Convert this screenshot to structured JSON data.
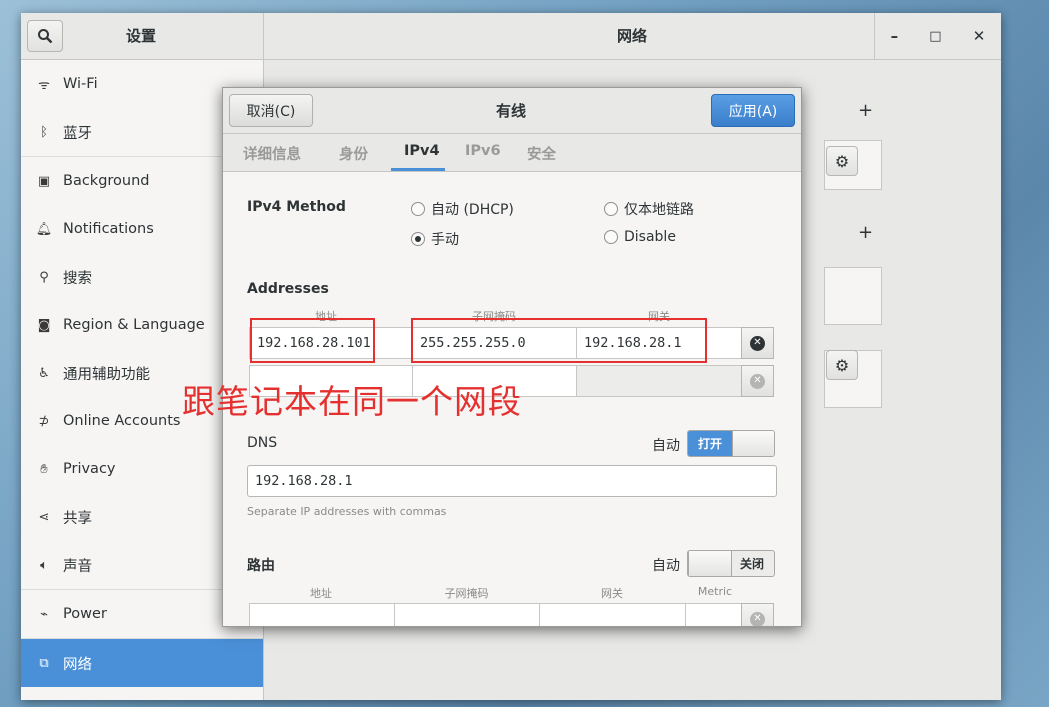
{
  "window": {
    "sidebar_title": "设置",
    "main_title": "网络",
    "controls": {
      "minimize": "–",
      "maximize": "□",
      "close": "✕"
    }
  },
  "sidebar": {
    "items": [
      {
        "label": "Wi-Fi",
        "icon": "wifi-icon",
        "glyph": "ᯤ"
      },
      {
        "label": "蓝牙",
        "icon": "bluetooth-icon",
        "glyph": "ᛒ"
      },
      {
        "label": "Background",
        "icon": "background-icon",
        "glyph": "▣"
      },
      {
        "label": "Notifications",
        "icon": "bell-icon",
        "glyph": "🔔︎"
      },
      {
        "label": "搜索",
        "icon": "search-icon",
        "glyph": "⚲"
      },
      {
        "label": "Region & Language",
        "icon": "camera-icon",
        "glyph": "◙"
      },
      {
        "label": "通用辅助功能",
        "icon": "accessibility-icon",
        "glyph": "♿︎"
      },
      {
        "label": "Online Accounts",
        "icon": "online-accounts-icon",
        "glyph": "⊅"
      },
      {
        "label": "Privacy",
        "icon": "hand-icon",
        "glyph": "✋︎"
      },
      {
        "label": "共享",
        "icon": "share-icon",
        "glyph": "⋖"
      },
      {
        "label": "声音",
        "icon": "speaker-icon",
        "glyph": "🔈︎"
      },
      {
        "label": "Power",
        "icon": "power-icon",
        "glyph": "⌁"
      },
      {
        "label": "网络",
        "icon": "network-icon",
        "glyph": "⧉",
        "active": true
      }
    ]
  },
  "dialog": {
    "cancel_label": "取消(C)",
    "title": "有线",
    "apply_label": "应用(A)",
    "tabs": [
      "详细信息",
      "身份",
      "IPv4",
      "IPv6",
      "安全"
    ],
    "active_tab": "IPv4",
    "ipv4_method_label": "IPv4 Method",
    "methods": [
      {
        "label": "自动 (DHCP)",
        "selected": false
      },
      {
        "label": "仅本地链路",
        "selected": false
      },
      {
        "label": "手动",
        "selected": true
      },
      {
        "label": "Disable",
        "selected": false
      }
    ],
    "addresses_label": "Addresses",
    "address_columns": [
      "地址",
      "子网掩码",
      "网关"
    ],
    "address_rows": [
      {
        "address": "192.168.28.101",
        "netmask": "255.255.255.0",
        "gateway": "192.168.28.1"
      },
      {
        "address": "",
        "netmask": "",
        "gateway": ""
      }
    ],
    "dns_label": "DNS",
    "dns_auto_label": "自动",
    "dns_switch_label": "打开",
    "dns_value": "192.168.28.1",
    "dns_hint": "Separate IP addresses with commas",
    "routes_label": "路由",
    "routes_auto_label": "自动",
    "routes_switch_label": "关闭",
    "route_columns": [
      "地址",
      "子网掩码",
      "网关",
      "Metric"
    ]
  },
  "annotation": {
    "text": "跟笔记本在同一个网段",
    "color": "#e53030"
  },
  "colors": {
    "accent": "#4a90d9",
    "annotation_red": "#e53030"
  }
}
